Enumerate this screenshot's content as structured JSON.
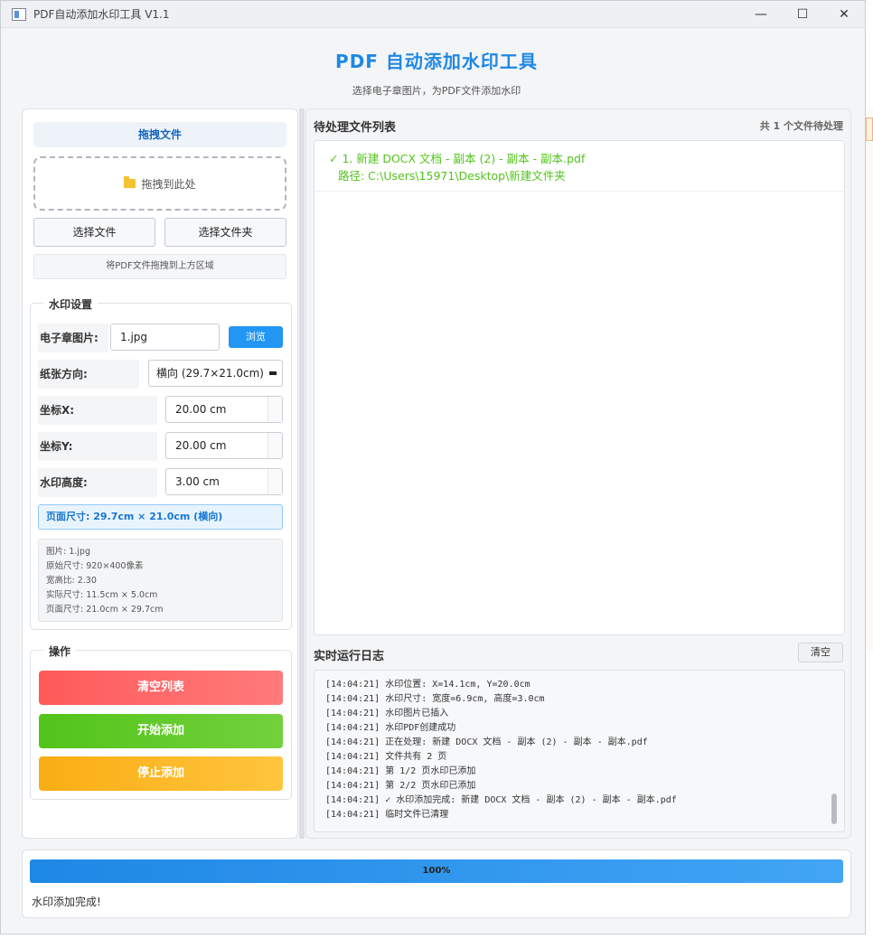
{
  "window": {
    "title": "PDF自动添加水印工具 V1.1",
    "controls": [
      "—",
      "☐",
      "✕"
    ]
  },
  "header": {
    "title": "PDF 自动添加水印工具",
    "subtitle": "选择电子章图片，为PDF文件添加水印"
  },
  "left": {
    "drag_title": "拖拽文件",
    "drop_label": "拖拽到此处",
    "select_file": "选择文件",
    "select_folder": "选择文件夹",
    "hint": "将PDF文件拖拽到上方区域",
    "watermark_group": {
      "title": "水印设置",
      "image_label": "电子章图片:",
      "image_value": "1.jpg",
      "browse": "浏览",
      "orientation_label": "纸张方向:",
      "orientation_value": "横向 (29.7×21.0cm)",
      "x_label": "坐标X:",
      "x_value": "20.00 cm",
      "y_label": "坐标Y:",
      "y_value": "20.00 cm",
      "height_label": "水印高度:",
      "height_value": "3.00 cm",
      "page_size": "页面尺寸: 29.7cm × 21.0cm (横向)",
      "info": [
        "图片: 1.jpg",
        "原始尺寸: 920×400像素",
        "宽高比: 2.30",
        "实际尺寸: 11.5cm × 5.0cm",
        "页面尺寸: 21.0cm × 29.7cm"
      ]
    },
    "ops_group": {
      "title": "操作",
      "clear": "清空列表",
      "start": "开始添加",
      "stop": "停止添加"
    }
  },
  "right": {
    "list_title": "待处理文件列表",
    "count": "共 1 个文件待处理",
    "files": [
      {
        "name": "✓ 1. 新建 DOCX 文档 - 副本 (2) - 副本 - 副本.pdf",
        "path": "路径: C:\\Users\\15971\\Desktop\\新建文件夹"
      }
    ],
    "log_title": "实时运行日志",
    "log_clear": "清空",
    "log": [
      "[14:04:21] 水印位置: X=14.1cm, Y=20.0cm",
      "[14:04:21] 水印尺寸: 宽度=6.9cm, 高度=3.0cm",
      "[14:04:21] 水印图片已插入",
      "[14:04:21] 水印PDF创建成功",
      "[14:04:21] 正在处理: 新建 DOCX 文档 - 副本 (2) - 副本 - 副本.pdf",
      "[14:04:21] 文件共有 2 页",
      "[14:04:21] 第 1/2 页水印已添加",
      "[14:04:21] 第 2/2 页水印已添加",
      "[14:04:21] ✓ 水印添加完成: 新建 DOCX 文档 - 副本 (2) - 副本 - 副本.pdf",
      "[14:04:21] 临时文件已清理"
    ]
  },
  "bottom": {
    "progress_fraction": 1.0,
    "progress_label": "100%",
    "status": "水印添加完成!"
  },
  "colors": {
    "accent": "#1e88e5",
    "success": "#52c41a",
    "danger": "#ff5a5a",
    "warning": "#faad14"
  }
}
